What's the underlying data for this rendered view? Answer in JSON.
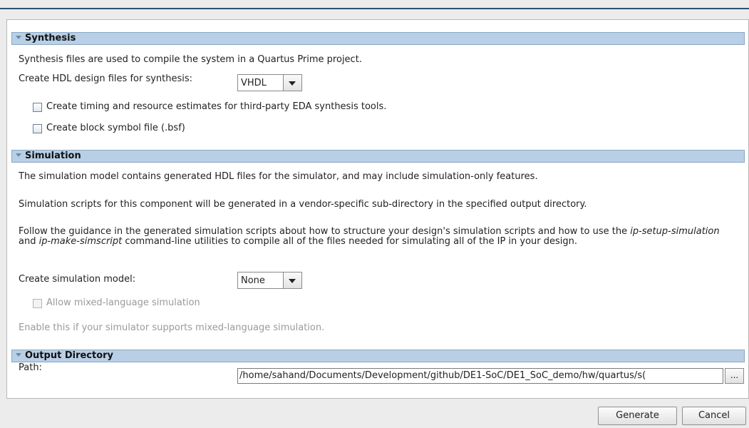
{
  "synthesis": {
    "header": "Synthesis",
    "description": "Synthesis files are used to compile the system in a Quartus Prime project.",
    "hdl_label": "Create HDL design files for synthesis:",
    "hdl_value": "VHDL",
    "timing_label": "Create timing and resource estimates for third-party EDA synthesis tools.",
    "bsf_label": "Create block symbol file (.bsf)"
  },
  "simulation": {
    "header": "Simulation",
    "line1": "The simulation model contains generated HDL files for the simulator, and may include simulation-only features.",
    "line2": "Simulation scripts for this component will be generated in a vendor-specific sub-directory in the specified output directory.",
    "guidance": {
      "part1": "Follow the guidance in the generated simulation scripts about how to structure your design's simulation scripts and how to use the ",
      "em1": "ip-setup-simulation",
      "part2": " and ",
      "em2": "ip-make-simscript",
      "part3": " command-line utilities to compile all of the files needed for simulating all of the IP in your design."
    },
    "model_label": "Create simulation model:",
    "model_value": "None",
    "mixed_label": "Allow mixed-language simulation",
    "mixed_hint": "Enable this if your simulator supports mixed-language simulation."
  },
  "output": {
    "header": "Output Directory",
    "path_label": "Path:",
    "path_value": "/home/sahand/Documents/Development/github/DE1-SoC/DE1_SoC_demo/hw/quartus/s(",
    "browse_label": "..."
  },
  "buttons": {
    "generate": "Generate",
    "cancel": "Cancel"
  }
}
